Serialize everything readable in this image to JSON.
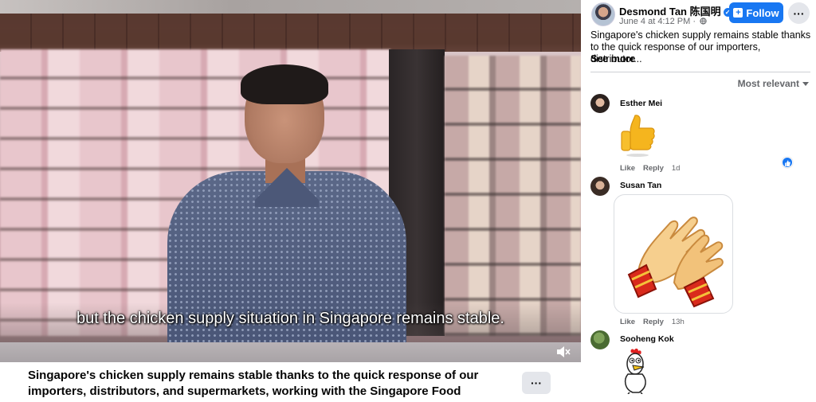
{
  "video": {
    "subtitle": "but the chicken supply situation in Singapore remains stable.",
    "caption": "Singapore's chicken supply remains stable thanks to the quick response of our importers, distributors, and supermarkets, working with the Singapore Food Agency...",
    "caption_more": "···"
  },
  "post": {
    "author": "Desmond Tan 陈国明",
    "meta": "June 4 at 4:12 PM ·",
    "follow_label": "Follow",
    "more_label": "···",
    "text": "Singapore's chicken supply remains stable thanks to the quick response of our importers, distributor...",
    "see_more": "See more"
  },
  "comments_sort": "Most relevant",
  "comments": [
    {
      "name": "Esther Mei",
      "like": "Like",
      "reply": "Reply",
      "time": "1d",
      "sticker": "thumbs-up"
    },
    {
      "name": "Susan Tan",
      "like": "Like",
      "reply": "Reply",
      "time": "13h",
      "sticker": "clapping-hands"
    },
    {
      "name": "Sooheng Kok",
      "sticker": "rooster-cartoon"
    }
  ],
  "colors": {
    "accent": "#1877f2",
    "secondary_text": "#65676b",
    "button_bg": "#e4e6eb"
  }
}
